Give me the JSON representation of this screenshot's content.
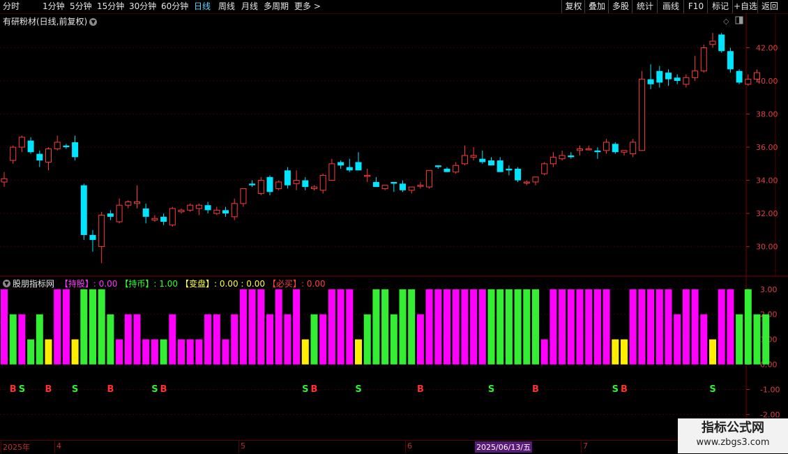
{
  "toolbar": {
    "periods": [
      "分时",
      "1分钟",
      "5分钟",
      "15分钟",
      "30分钟",
      "60分钟",
      "日线",
      "周线",
      "月线",
      "多周期",
      "更多 >"
    ],
    "active_period": "日线",
    "right_buttons": [
      "复权",
      "叠加",
      "多股",
      "统计",
      "画线",
      "F10",
      "标记",
      "+自选",
      "返回"
    ]
  },
  "panel": {
    "title": "有研粉材(日线,前复权)",
    "yticks": [
      "42.00",
      "40.00",
      "38.00",
      "36.00",
      "34.00",
      "32.00",
      "30.00"
    ]
  },
  "indicator": {
    "name": "股朋指标网",
    "items": [
      {
        "label": "【持股】",
        "sep": ": ",
        "value": "0.00",
        "color": "#ff33ff"
      },
      {
        "label": "【持币】",
        "sep": ": ",
        "value": "1.00",
        "color": "#33ff33"
      },
      {
        "label": "【变盘】",
        "sep": ": ",
        "value": "0.00 : 0.00",
        "color": "#ffff33"
      },
      {
        "label": "【必买】",
        "sep": ": ",
        "value": "0.00",
        "color": "#ff4040"
      }
    ],
    "yticks": [
      "3.00",
      "2.00",
      "1.00",
      "0.00",
      "-1.00",
      "-2.00"
    ]
  },
  "dates": {
    "labels": [
      "2025年",
      "4",
      "5",
      "6",
      "7"
    ],
    "highlight": "2025/06/13/五"
  },
  "watermark": {
    "line1": "指标公式网",
    "line2": "www.zbgs3.com"
  },
  "colors": {
    "up": "#ff3b3b",
    "down": "#00e5ff",
    "hold_stock": "#ff00ff",
    "hold_cash": "#33ee33",
    "turn": "#ffee00"
  },
  "chart_data": [
    {
      "type": "candlestick",
      "title": "有研粉材(日线,前复权)",
      "ylim": [
        28.3,
        43.2
      ],
      "candles": [
        [
          33.9,
          34.5,
          33.6,
          34.1
        ],
        [
          35.2,
          36.1,
          35.0,
          36.0
        ],
        [
          36.0,
          36.7,
          35.7,
          36.6
        ],
        [
          36.4,
          36.6,
          35.6,
          35.7
        ],
        [
          35.6,
          35.8,
          34.8,
          35.2
        ],
        [
          35.1,
          36.0,
          34.6,
          35.9
        ],
        [
          35.9,
          36.7,
          35.8,
          36.3
        ],
        [
          36.1,
          36.2,
          35.9,
          36.0
        ],
        [
          36.3,
          36.7,
          35.2,
          35.4
        ],
        [
          33.7,
          33.8,
          30.4,
          30.7
        ],
        [
          30.7,
          31.0,
          29.7,
          30.4
        ],
        [
          30.0,
          32.1,
          29.0,
          31.9
        ],
        [
          32.0,
          32.2,
          31.6,
          31.8
        ],
        [
          31.5,
          32.9,
          31.4,
          32.5
        ],
        [
          32.5,
          32.8,
          32.3,
          32.7
        ],
        [
          32.6,
          33.7,
          32.3,
          32.7
        ],
        [
          32.3,
          32.6,
          31.4,
          31.8
        ],
        [
          31.6,
          31.9,
          31.5,
          31.7
        ],
        [
          31.8,
          32.0,
          31.3,
          31.5
        ],
        [
          31.3,
          32.4,
          31.2,
          32.3
        ],
        [
          32.1,
          32.3,
          32.0,
          32.2
        ],
        [
          32.2,
          32.6,
          32.1,
          32.5
        ],
        [
          32.3,
          32.6,
          31.9,
          32.5
        ],
        [
          32.5,
          32.7,
          32.0,
          32.2
        ],
        [
          32.0,
          32.4,
          31.9,
          32.2
        ],
        [
          32.2,
          32.4,
          31.8,
          32.0
        ],
        [
          31.8,
          32.9,
          31.6,
          32.6
        ],
        [
          32.6,
          33.5,
          32.4,
          33.5
        ],
        [
          33.8,
          34.0,
          33.6,
          33.7
        ],
        [
          33.2,
          34.2,
          33.1,
          34.0
        ],
        [
          34.2,
          34.3,
          33.1,
          33.3
        ],
        [
          33.5,
          34.0,
          33.4,
          33.9
        ],
        [
          34.6,
          34.8,
          33.5,
          33.7
        ],
        [
          33.8,
          34.6,
          33.4,
          34.0
        ],
        [
          34.0,
          34.2,
          33.4,
          33.6
        ],
        [
          33.5,
          33.7,
          33.4,
          33.6
        ],
        [
          33.4,
          34.4,
          33.2,
          34.3
        ],
        [
          34.0,
          35.3,
          34.2,
          35.0
        ],
        [
          35.1,
          35.2,
          34.7,
          34.9
        ],
        [
          34.8,
          35.3,
          34.5,
          34.6
        ],
        [
          35.1,
          35.7,
          34.6,
          34.6
        ],
        [
          34.3,
          34.7,
          33.9,
          34.3
        ],
        [
          33.9,
          34.2,
          33.6,
          33.6
        ],
        [
          33.5,
          33.6,
          33.4,
          33.7
        ],
        [
          33.9,
          33.9,
          33.3,
          33.8
        ],
        [
          33.8,
          34.0,
          33.3,
          33.4
        ],
        [
          33.4,
          33.4,
          33.2,
          33.6
        ],
        [
          33.7,
          33.9,
          33.5,
          33.7
        ],
        [
          33.6,
          34.5,
          33.5,
          34.6
        ],
        [
          34.9,
          34.9,
          34.7,
          34.8
        ],
        [
          34.7,
          34.8,
          34.5,
          34.5
        ],
        [
          34.5,
          35.1,
          34.4,
          34.9
        ],
        [
          35.0,
          36.1,
          34.9,
          35.5
        ],
        [
          35.4,
          36.0,
          35.2,
          35.5
        ],
        [
          35.3,
          35.8,
          35.0,
          35.1
        ],
        [
          35.2,
          35.4,
          35.0,
          34.9
        ],
        [
          35.2,
          35.4,
          34.6,
          34.5
        ],
        [
          34.7,
          34.9,
          34.3,
          34.6
        ],
        [
          34.7,
          34.8,
          33.9,
          34.0
        ],
        [
          33.9,
          34.0,
          33.7,
          33.9
        ],
        [
          33.9,
          34.2,
          33.7,
          34.2
        ],
        [
          34.4,
          35.1,
          34.3,
          35.0
        ],
        [
          35.0,
          35.7,
          34.8,
          35.4
        ],
        [
          35.3,
          35.8,
          35.2,
          35.5
        ],
        [
          35.5,
          35.7,
          35.3,
          35.4
        ],
        [
          35.8,
          36.1,
          35.5,
          35.9
        ],
        [
          35.9,
          36.1,
          35.8,
          35.9
        ],
        [
          35.8,
          36.0,
          35.3,
          35.7
        ],
        [
          35.8,
          36.5,
          35.6,
          36.3
        ],
        [
          36.2,
          36.3,
          35.6,
          35.7
        ],
        [
          35.7,
          35.8,
          35.5,
          35.8
        ],
        [
          35.6,
          36.5,
          35.4,
          36.3
        ],
        [
          35.8,
          40.6,
          37.5,
          40.1
        ],
        [
          40.1,
          41.0,
          39.5,
          39.8
        ],
        [
          40.6,
          40.9,
          39.6,
          39.9
        ],
        [
          40.5,
          40.7,
          39.7,
          40.1
        ],
        [
          40.2,
          40.4,
          39.8,
          40.0
        ],
        [
          39.8,
          40.4,
          39.6,
          40.2
        ],
        [
          40.2,
          41.5,
          40.0,
          40.6
        ],
        [
          40.6,
          42.2,
          40.5,
          42.0
        ],
        [
          42.2,
          42.9,
          42.0,
          42.4
        ],
        [
          42.8,
          42.9,
          41.7,
          41.8
        ],
        [
          41.8,
          42.0,
          40.5,
          40.7
        ],
        [
          40.6,
          40.7,
          39.8,
          39.9
        ],
        [
          39.8,
          40.4,
          39.7,
          40.1
        ],
        [
          40.1,
          40.7,
          40.0,
          40.5
        ]
      ]
    },
    {
      "type": "bar",
      "title": "股朋指标网",
      "ylim": [
        -2.6,
        3.3
      ],
      "values": [
        3,
        2,
        2,
        1,
        2,
        1,
        3,
        3,
        1,
        3,
        3,
        3,
        2,
        1,
        2,
        2,
        1,
        1,
        1,
        2,
        1,
        1,
        1,
        2,
        2,
        1,
        2,
        3,
        3,
        3,
        2,
        3,
        2,
        3,
        1,
        2,
        2,
        3,
        3,
        3,
        1,
        2,
        3,
        3,
        2,
        3,
        3,
        2,
        3,
        3,
        3,
        3,
        3,
        3,
        3,
        3,
        3,
        3,
        3,
        3,
        3,
        1,
        3,
        3,
        3,
        3,
        3,
        3,
        3,
        1,
        1,
        3,
        3,
        3,
        3,
        3,
        2,
        3,
        3,
        2,
        1,
        3,
        3,
        2,
        3,
        2,
        2
      ],
      "colors": [
        "m",
        "g",
        "m",
        "g",
        "g",
        "y",
        "m",
        "m",
        "y",
        "g",
        "g",
        "g",
        "g",
        "m",
        "m",
        "m",
        "m",
        "m",
        "g",
        "m",
        "m",
        "m",
        "m",
        "m",
        "m",
        "m",
        "m",
        "m",
        "m",
        "m",
        "m",
        "m",
        "m",
        "m",
        "y",
        "g",
        "m",
        "m",
        "m",
        "m",
        "y",
        "g",
        "g",
        "g",
        "g",
        "g",
        "g",
        "m",
        "m",
        "m",
        "m",
        "m",
        "m",
        "m",
        "m",
        "g",
        "g",
        "g",
        "g",
        "g",
        "g",
        "m",
        "m",
        "m",
        "m",
        "m",
        "m",
        "m",
        "m",
        "y",
        "y",
        "m",
        "m",
        "m",
        "m",
        "m",
        "m",
        "m",
        "m",
        "m",
        "y",
        "m",
        "m",
        "g",
        "g",
        "g",
        "g"
      ],
      "signals": [
        {
          "i": 1,
          "text": "B",
          "color": "#ff3030"
        },
        {
          "i": 2,
          "text": "S",
          "color": "#33ee33"
        },
        {
          "i": 5,
          "text": "B",
          "color": "#ff3030"
        },
        {
          "i": 8,
          "text": "S",
          "color": "#33ee33"
        },
        {
          "i": 12,
          "text": "B",
          "color": "#ff3030"
        },
        {
          "i": 17,
          "text": "S",
          "color": "#33ee33"
        },
        {
          "i": 18,
          "text": "B",
          "color": "#ff3030"
        },
        {
          "i": 34,
          "text": "S",
          "color": "#33ee33"
        },
        {
          "i": 35,
          "text": "B",
          "color": "#ff3030"
        },
        {
          "i": 40,
          "text": "S",
          "color": "#33ee33"
        },
        {
          "i": 47,
          "text": "B",
          "color": "#ff3030"
        },
        {
          "i": 55,
          "text": "S",
          "color": "#33ee33"
        },
        {
          "i": 60,
          "text": "B",
          "color": "#ff3030"
        },
        {
          "i": 69,
          "text": "S",
          "color": "#33ee33"
        },
        {
          "i": 70,
          "text": "B",
          "color": "#ff3030"
        },
        {
          "i": 80,
          "text": "S",
          "color": "#33ee33"
        }
      ]
    }
  ]
}
